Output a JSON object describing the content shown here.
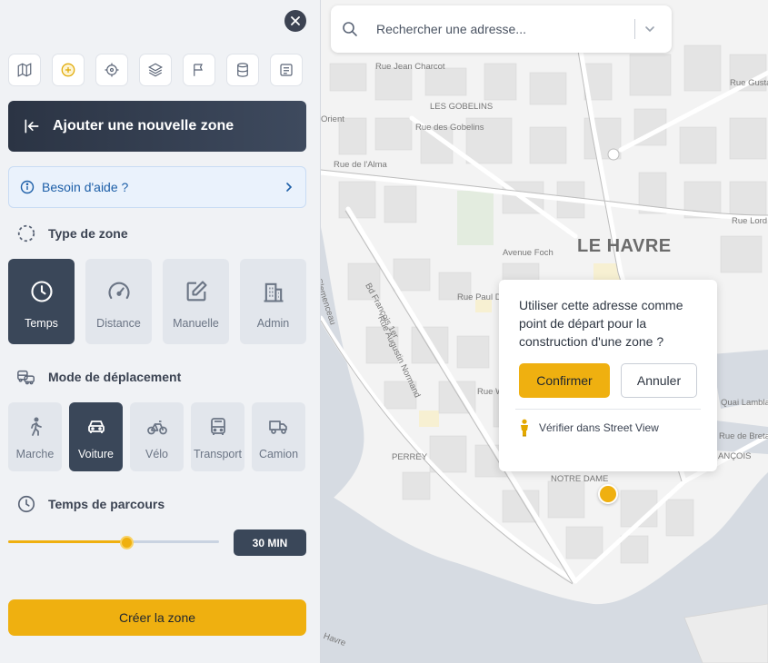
{
  "sidebar": {
    "toolbar": [
      {
        "name": "map-icon"
      },
      {
        "name": "add-circle-icon",
        "active": true
      },
      {
        "name": "crosshair-icon"
      },
      {
        "name": "layers-icon"
      },
      {
        "name": "flag-icon"
      },
      {
        "name": "database-icon"
      },
      {
        "name": "document-icon"
      }
    ],
    "header": {
      "title": "Ajouter une nouvelle zone"
    },
    "help": {
      "label": "Besoin d'aide ?"
    },
    "zone_type": {
      "title": "Type de zone",
      "options": [
        {
          "label": "Temps",
          "icon": "clock-icon",
          "active": true
        },
        {
          "label": "Distance",
          "icon": "gauge-icon",
          "active": false
        },
        {
          "label": "Manuelle",
          "icon": "edit-icon",
          "active": false
        },
        {
          "label": "Admin",
          "icon": "building-icon",
          "active": false
        }
      ]
    },
    "travel_mode": {
      "title": "Mode de déplacement",
      "options": [
        {
          "label": "Marche",
          "icon": "walk-icon",
          "active": false
        },
        {
          "label": "Voiture",
          "icon": "car-icon",
          "active": true
        },
        {
          "label": "Vélo",
          "icon": "bike-icon",
          "active": false
        },
        {
          "label": "Transport",
          "icon": "bus-icon",
          "active": false
        },
        {
          "label": "Camion",
          "icon": "truck-icon",
          "active": false
        }
      ]
    },
    "travel_time": {
      "title": "Temps de parcours",
      "slider_fraction": 0.56,
      "value_label": "30 MIN"
    },
    "create_button": "Créer la zone"
  },
  "map": {
    "search": {
      "placeholder": "Rechercher une adresse..."
    },
    "city_label": "LE HAVRE",
    "street_labels": [
      "Rue Jean Charcot",
      "LES GOBELINS",
      "Rue des Gobelins",
      "Rue de l'Alma",
      "Avenue Foch",
      "Rue Paul D",
      "Bd François 1er",
      "Rue Augustin Normand",
      "Clemenceau",
      "Rue W",
      "PERREY",
      "NOTRE DAME",
      "Rue Lord Ki",
      "Quai Lambla",
      "Rue de Bretagn",
      "ANÇOIS",
      "Rue Gustav",
      "Havre",
      "Orient"
    ],
    "popup": {
      "message": "Utiliser cette adresse comme point de départ pour la construction d'une zone ?",
      "confirm": "Confirmer",
      "cancel": "Annuler",
      "street_view": "Vérifier dans Street View"
    },
    "colors": {
      "accent": "#efb010",
      "dark": "#3a4759",
      "water": "#d6dbe2"
    }
  }
}
